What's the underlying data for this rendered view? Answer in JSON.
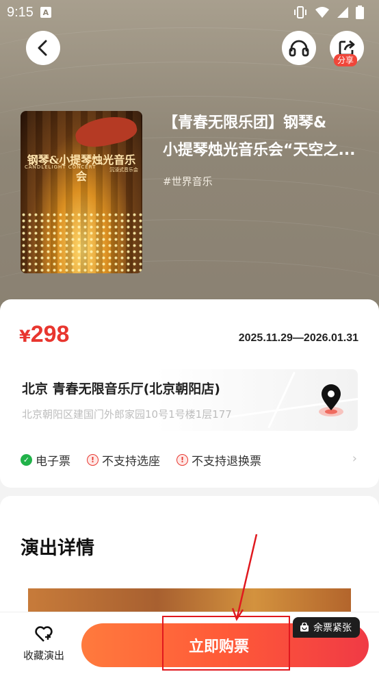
{
  "status_bar": {
    "time": "9:15",
    "notification_icon": "A"
  },
  "header": {
    "back_icon": "chevron-left-icon",
    "audio_icon": "headphones-icon",
    "share_icon": "share-icon",
    "share_badge": "分享"
  },
  "poster": {
    "title": "钢琴&小提琴烛光音乐会",
    "subtitle": "CANDLELIGHT CONCERT",
    "subtitle2": "沉浸式音乐会"
  },
  "show": {
    "title_line1": "【青春无限乐团】钢琴&",
    "title_line2": "小提琴烛光音乐会“天空之...",
    "genre": "#世界音乐"
  },
  "info": {
    "price_symbol": "¥",
    "price_value": "298",
    "date_range": "2025.11.29—2026.01.31",
    "venue_name": "北京  青春无限音乐厅(北京朝阳店)",
    "venue_address": "北京朝阳区建国门外郎家园10号1号楼1层177",
    "tags": [
      {
        "label": "电子票",
        "status": "ok"
      },
      {
        "label": "不支持选座",
        "status": "no"
      },
      {
        "label": "不支持退换票",
        "status": "no"
      }
    ]
  },
  "details": {
    "title": "演出详情"
  },
  "bottom_bar": {
    "favorite_label": "收藏演出",
    "buy_label": "立即购票",
    "scarcity_badge": "余票紧张"
  },
  "colors": {
    "accent_red": "#e8362f",
    "buy_gradient_start": "#ff7a3d",
    "buy_gradient_end": "#f03a45",
    "hero_bg": "#8f8676",
    "annotation_red": "#e0181e"
  }
}
